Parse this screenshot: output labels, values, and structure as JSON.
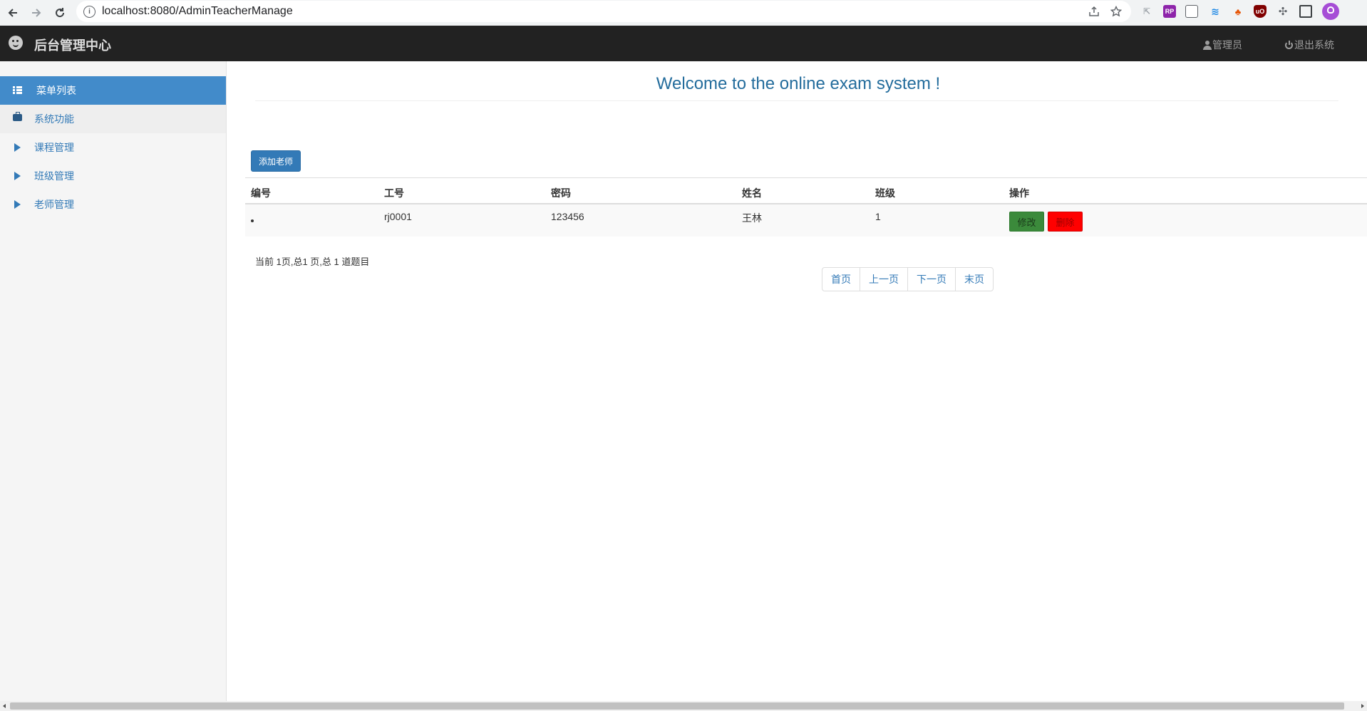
{
  "browser": {
    "url": "localhost:8080/AdminTeacherManage",
    "extensions": [
      "share-icon",
      "star-icon",
      "cursor-ext-icon",
      "rp-ext-icon",
      "grid-ext-icon",
      "bird-ext-icon",
      "tree-ext-icon",
      "ublock-ext-icon",
      "puzzle-icon",
      "sidepanel-icon",
      "profile-avatar"
    ]
  },
  "header": {
    "brand": "后台管理中心",
    "admin_label": "管理员",
    "logout_label": "退出系统"
  },
  "sidebar": {
    "items": [
      {
        "label": "菜单列表",
        "icon": "grid-list-icon",
        "state": "active"
      },
      {
        "label": "系统功能",
        "icon": "briefcase-icon",
        "state": "section"
      },
      {
        "label": "课程管理",
        "icon": "triangle-right-icon"
      },
      {
        "label": "班级管理",
        "icon": "triangle-right-icon"
      },
      {
        "label": "老师管理",
        "icon": "triangle-right-icon"
      }
    ]
  },
  "main": {
    "welcome": "Welcome to the online exam system !",
    "add_button": "添加老师",
    "table": {
      "columns": [
        "编号",
        "工号",
        "密码",
        "姓名",
        "班级",
        "操作"
      ],
      "rows": [
        {
          "id": "",
          "job_no": "rj0001",
          "password": "123456",
          "name": "王林",
          "class": "1",
          "edit": "修改",
          "delete": "删除"
        }
      ]
    },
    "page_info": "当前 1页,总1 页,总 1 道题目",
    "pager": [
      "首页",
      "上一页",
      "下一页",
      "末页"
    ]
  },
  "colors": {
    "topbar": "#222222",
    "sidebar_active": "#428bca",
    "primary": "#337ab7",
    "edit": "#3b8a3b",
    "delete": "#ff0000",
    "welcome": "#236c9c"
  }
}
